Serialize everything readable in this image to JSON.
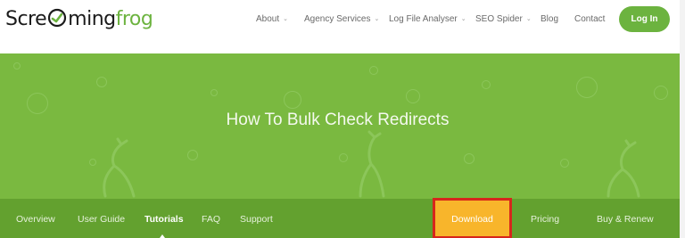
{
  "header": {
    "logo": {
      "part1": "Scre",
      "part2": "ming",
      "part3": "frog"
    },
    "nav": [
      {
        "label": "About",
        "has_dropdown": true
      },
      {
        "label": "Agency Services",
        "has_dropdown": true
      },
      {
        "label": "Log File Analyser",
        "has_dropdown": true
      },
      {
        "label": "SEO Spider",
        "has_dropdown": true
      },
      {
        "label": "Blog",
        "has_dropdown": false
      },
      {
        "label": "Contact",
        "has_dropdown": false
      }
    ],
    "login_label": "Log In"
  },
  "hero": {
    "title": "How To Bulk Check Redirects"
  },
  "subnav": {
    "items": [
      "Overview",
      "User Guide",
      "Tutorials",
      "FAQ",
      "Support"
    ],
    "active": "Tutorials",
    "download_label": "Download",
    "pricing_label": "Pricing",
    "buy_label": "Buy & Renew"
  },
  "colors": {
    "brand_green": "#6cb33f",
    "hero_green": "#7ab940",
    "subnav_green": "#63a12f",
    "download_orange": "#f8b52b",
    "highlight_red": "#d7261c"
  },
  "icons": {
    "chevron": "chevron-down-icon",
    "logo_mark": "frog-logo-icon"
  }
}
